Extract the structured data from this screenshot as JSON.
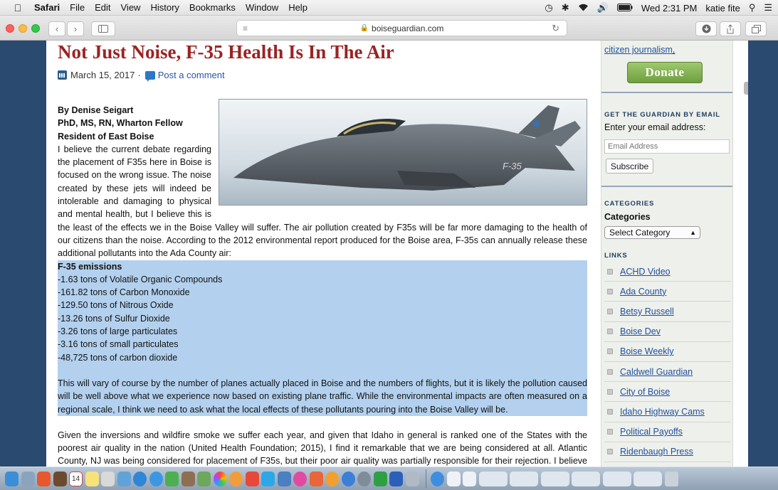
{
  "menubar": {
    "app": "Safari",
    "items": [
      "File",
      "Edit",
      "View",
      "History",
      "Bookmarks",
      "Window",
      "Help"
    ],
    "clock": "Wed 2:31 PM",
    "user": "katie fite"
  },
  "toolbar": {
    "url": "boiseguardian.com"
  },
  "post": {
    "title": "Not Just Noise, F-35 Health Is In The Air",
    "date": "March 15, 2017",
    "separator": "·",
    "comment_link": "Post a comment",
    "byline": "By Denise Seigart",
    "credentials": "PhD, MS, RN, Wharton Fellow",
    "residence": "Resident of East Boise",
    "para1": "I believe the current debate regarding the placement of F35s here in Boise is focused on the wrong issue. The noise created by these jets will indeed be intolerable and damaging to physical and mental health, but I believe this is the least of the effects we in the Boise Valley will suffer. The air pollution created by F35s will be far more damaging to the health of our citizens than the noise. According to the 2012 environmental report produced for the Boise area, F-35s can annually release these additional pollutants into the Ada County air:",
    "emissions_heading": "F-35 emissions",
    "emissions": [
      "-1.63 tons of Volatile Organic Compounds",
      "-161.82 tons of Carbon Monoxide",
      "-129.50 tons of Nitrous Oxide",
      "-13.26 tons of Sulfur Dioxide",
      "-3.26 tons of large particulates",
      "-3.16 tons of small particulates",
      "-48,725 tons of carbon dioxide"
    ],
    "para2": "This will vary of course by the number of planes actually placed in Boise and the numbers of flights, but it is likely the pollution caused will be well above what we experience now based on existing plane traffic. While the environmental impacts are often measured on a regional scale, I think we need to ask what the local effects of these pollutants pouring into the Boise Valley will be.",
    "para3": "Given the inversions and wildfire smoke we suffer each year, and given that Idaho in general is ranked one of the States with the poorest air quality in the nation (United Health Foundation; 2015), I find it remarkable that we are being considered at all. Atlantic County, NJ was being considered for placement of F35s, but their poor air quality was partially responsible for their rejection. I believe we can make the same argument here. As noted in a Burlington Vermont report"
  },
  "image": {
    "tail_text": "F-35"
  },
  "sidebar": {
    "citizen_link": "citizen journalism",
    "citizen_period": ".",
    "donate_label": "Donate",
    "email_widget_title": "GET THE GUARDIAN BY EMAIL",
    "email_prompt": "Enter your email address:",
    "email_placeholder": "Email Address",
    "subscribe_label": "Subscribe",
    "categories_title": "CATEGORIES",
    "categories_label": "Categories",
    "category_selected": "Select Category",
    "links_title": "LINKS",
    "links": [
      "ACHD Video",
      "Ada County",
      "Betsy Russell",
      "Boise Dev",
      "Boise Weekly",
      "Caldwell Guardian",
      "City of Boise",
      "Idaho Highway Cams",
      "Political Payoffs",
      "Ridenbaugh Press"
    ]
  },
  "dock": {
    "calendar_day": "14"
  },
  "colors": {
    "title_red": "#9b2323",
    "link_blue": "#1f4f9c",
    "highlight": "#b3d1ee",
    "donate_green": "#7fae4f",
    "desktop_blue": "#2b4a6f"
  }
}
